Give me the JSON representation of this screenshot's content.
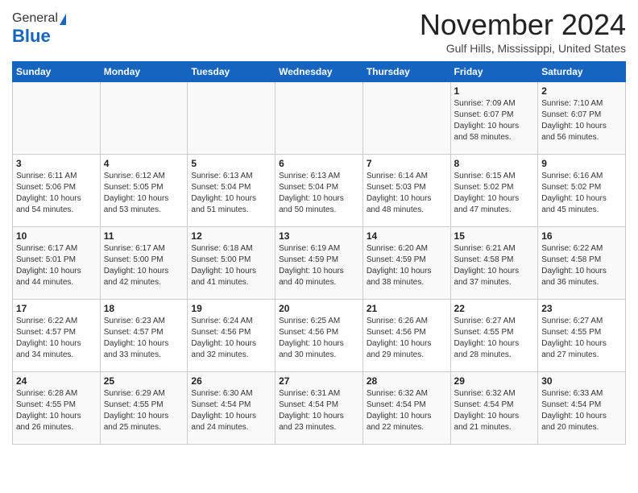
{
  "header": {
    "logo_general": "General",
    "logo_blue": "Blue",
    "month_title": "November 2024",
    "location": "Gulf Hills, Mississippi, United States"
  },
  "weekdays": [
    "Sunday",
    "Monday",
    "Tuesday",
    "Wednesday",
    "Thursday",
    "Friday",
    "Saturday"
  ],
  "weeks": [
    [
      {
        "day": "",
        "info": ""
      },
      {
        "day": "",
        "info": ""
      },
      {
        "day": "",
        "info": ""
      },
      {
        "day": "",
        "info": ""
      },
      {
        "day": "",
        "info": ""
      },
      {
        "day": "1",
        "info": "Sunrise: 7:09 AM\nSunset: 6:07 PM\nDaylight: 10 hours\nand 58 minutes."
      },
      {
        "day": "2",
        "info": "Sunrise: 7:10 AM\nSunset: 6:07 PM\nDaylight: 10 hours\nand 56 minutes."
      }
    ],
    [
      {
        "day": "3",
        "info": "Sunrise: 6:11 AM\nSunset: 5:06 PM\nDaylight: 10 hours\nand 54 minutes."
      },
      {
        "day": "4",
        "info": "Sunrise: 6:12 AM\nSunset: 5:05 PM\nDaylight: 10 hours\nand 53 minutes."
      },
      {
        "day": "5",
        "info": "Sunrise: 6:13 AM\nSunset: 5:04 PM\nDaylight: 10 hours\nand 51 minutes."
      },
      {
        "day": "6",
        "info": "Sunrise: 6:13 AM\nSunset: 5:04 PM\nDaylight: 10 hours\nand 50 minutes."
      },
      {
        "day": "7",
        "info": "Sunrise: 6:14 AM\nSunset: 5:03 PM\nDaylight: 10 hours\nand 48 minutes."
      },
      {
        "day": "8",
        "info": "Sunrise: 6:15 AM\nSunset: 5:02 PM\nDaylight: 10 hours\nand 47 minutes."
      },
      {
        "day": "9",
        "info": "Sunrise: 6:16 AM\nSunset: 5:02 PM\nDaylight: 10 hours\nand 45 minutes."
      }
    ],
    [
      {
        "day": "10",
        "info": "Sunrise: 6:17 AM\nSunset: 5:01 PM\nDaylight: 10 hours\nand 44 minutes."
      },
      {
        "day": "11",
        "info": "Sunrise: 6:17 AM\nSunset: 5:00 PM\nDaylight: 10 hours\nand 42 minutes."
      },
      {
        "day": "12",
        "info": "Sunrise: 6:18 AM\nSunset: 5:00 PM\nDaylight: 10 hours\nand 41 minutes."
      },
      {
        "day": "13",
        "info": "Sunrise: 6:19 AM\nSunset: 4:59 PM\nDaylight: 10 hours\nand 40 minutes."
      },
      {
        "day": "14",
        "info": "Sunrise: 6:20 AM\nSunset: 4:59 PM\nDaylight: 10 hours\nand 38 minutes."
      },
      {
        "day": "15",
        "info": "Sunrise: 6:21 AM\nSunset: 4:58 PM\nDaylight: 10 hours\nand 37 minutes."
      },
      {
        "day": "16",
        "info": "Sunrise: 6:22 AM\nSunset: 4:58 PM\nDaylight: 10 hours\nand 36 minutes."
      }
    ],
    [
      {
        "day": "17",
        "info": "Sunrise: 6:22 AM\nSunset: 4:57 PM\nDaylight: 10 hours\nand 34 minutes."
      },
      {
        "day": "18",
        "info": "Sunrise: 6:23 AM\nSunset: 4:57 PM\nDaylight: 10 hours\nand 33 minutes."
      },
      {
        "day": "19",
        "info": "Sunrise: 6:24 AM\nSunset: 4:56 PM\nDaylight: 10 hours\nand 32 minutes."
      },
      {
        "day": "20",
        "info": "Sunrise: 6:25 AM\nSunset: 4:56 PM\nDaylight: 10 hours\nand 30 minutes."
      },
      {
        "day": "21",
        "info": "Sunrise: 6:26 AM\nSunset: 4:56 PM\nDaylight: 10 hours\nand 29 minutes."
      },
      {
        "day": "22",
        "info": "Sunrise: 6:27 AM\nSunset: 4:55 PM\nDaylight: 10 hours\nand 28 minutes."
      },
      {
        "day": "23",
        "info": "Sunrise: 6:27 AM\nSunset: 4:55 PM\nDaylight: 10 hours\nand 27 minutes."
      }
    ],
    [
      {
        "day": "24",
        "info": "Sunrise: 6:28 AM\nSunset: 4:55 PM\nDaylight: 10 hours\nand 26 minutes."
      },
      {
        "day": "25",
        "info": "Sunrise: 6:29 AM\nSunset: 4:55 PM\nDaylight: 10 hours\nand 25 minutes."
      },
      {
        "day": "26",
        "info": "Sunrise: 6:30 AM\nSunset: 4:54 PM\nDaylight: 10 hours\nand 24 minutes."
      },
      {
        "day": "27",
        "info": "Sunrise: 6:31 AM\nSunset: 4:54 PM\nDaylight: 10 hours\nand 23 minutes."
      },
      {
        "day": "28",
        "info": "Sunrise: 6:32 AM\nSunset: 4:54 PM\nDaylight: 10 hours\nand 22 minutes."
      },
      {
        "day": "29",
        "info": "Sunrise: 6:32 AM\nSunset: 4:54 PM\nDaylight: 10 hours\nand 21 minutes."
      },
      {
        "day": "30",
        "info": "Sunrise: 6:33 AM\nSunset: 4:54 PM\nDaylight: 10 hours\nand 20 minutes."
      }
    ]
  ]
}
